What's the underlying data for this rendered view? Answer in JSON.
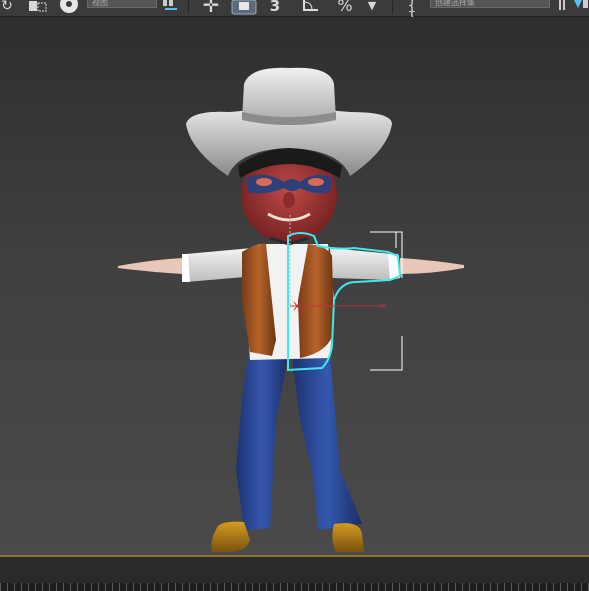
{
  "toolbar": {
    "view_dropdown": {
      "value": "视图"
    },
    "selection_set_field": {
      "value": "创建选择集"
    },
    "snap_angle_label": "3",
    "percent_snap_label": "%"
  },
  "colors": {
    "selection_outline": "#3fe8ec",
    "bracket": "#ffffff",
    "ground_line": "#8a7430",
    "axis_red": "#c0303a"
  }
}
